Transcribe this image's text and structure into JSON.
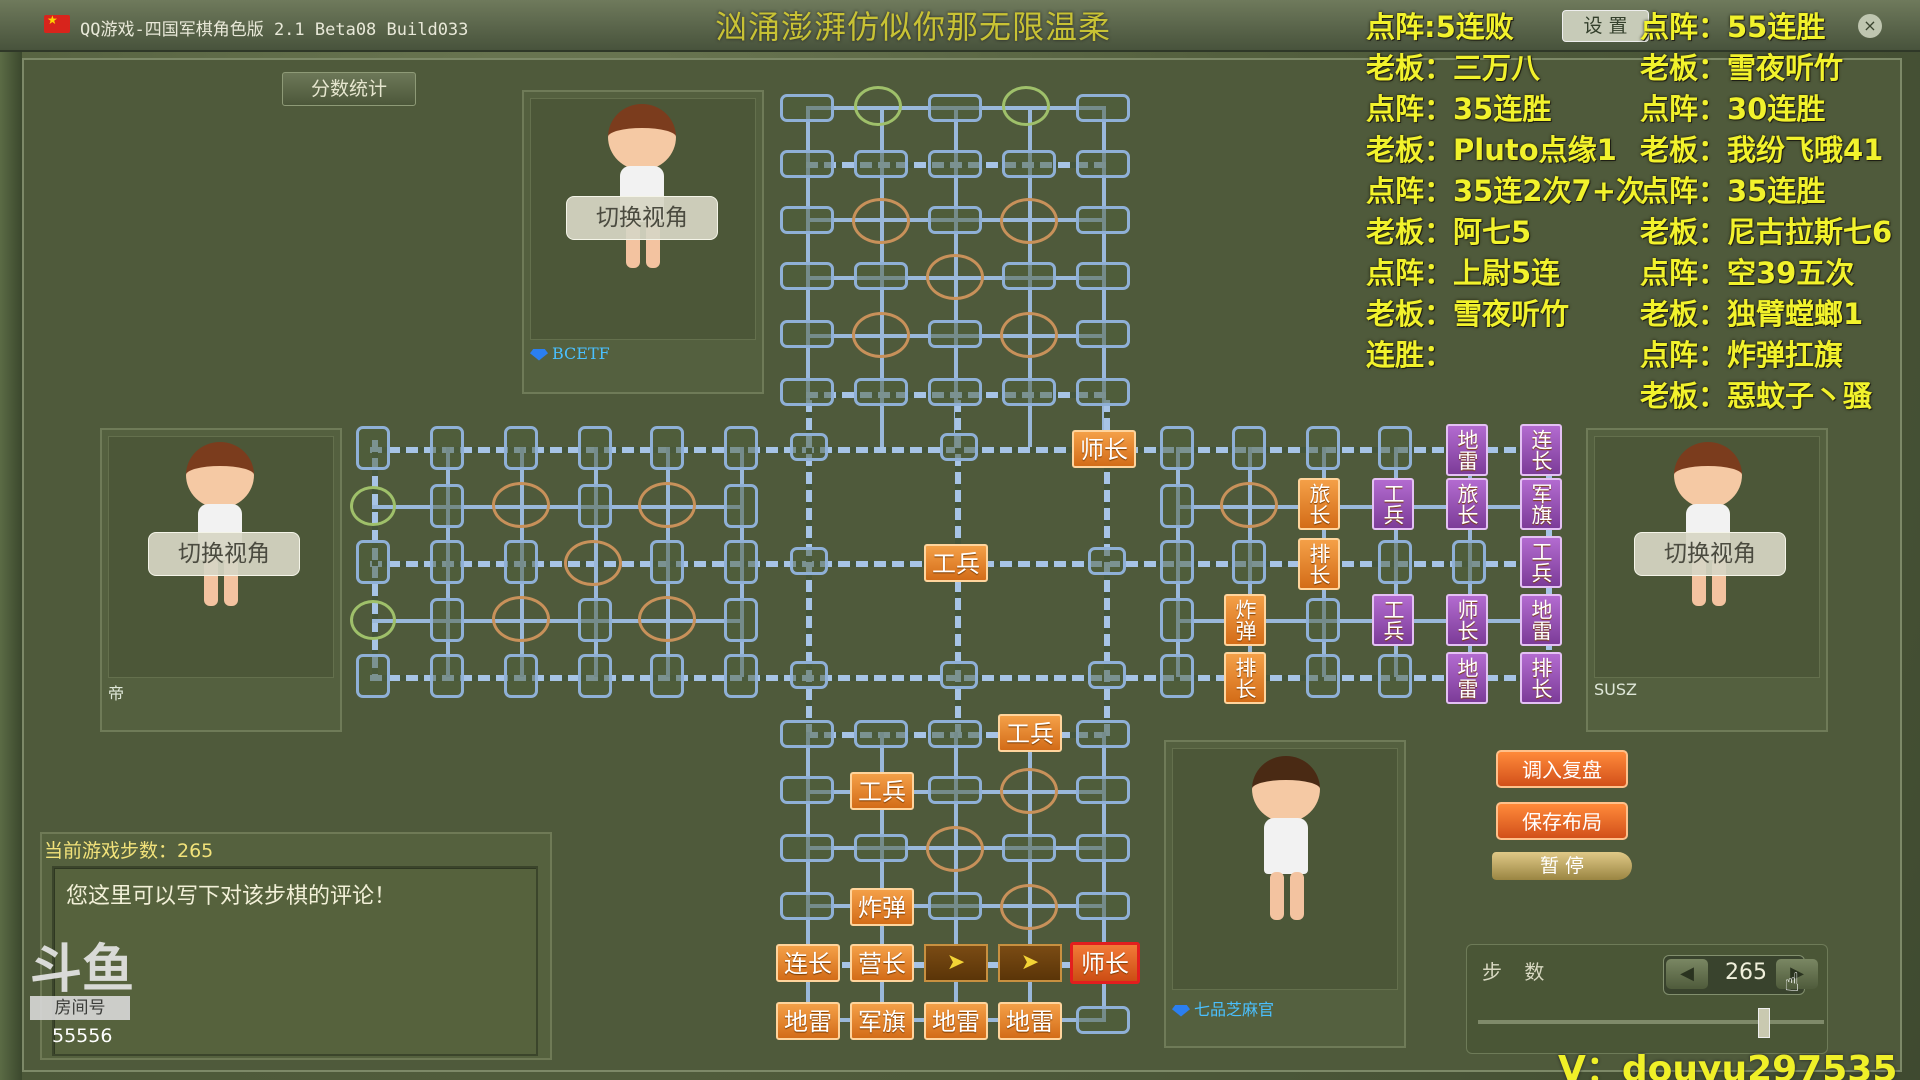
{
  "window": {
    "title": "QQ游戏-四国军棋角色版 2.1 Beta08 Build033",
    "song": "汹涌澎湃仿似你那无限温柔",
    "settings_label": "设 置",
    "close_label": "×"
  },
  "left_panel": {
    "score_stats": "分数统计",
    "switch_view": "切换视角"
  },
  "players": {
    "top": {
      "name": "BCETF"
    },
    "left": {
      "name": "帝"
    },
    "right": {
      "name": "SUSZ"
    },
    "bottom": {
      "name": "七品芝麻官"
    }
  },
  "comment": {
    "header": "当前游戏步数：265",
    "placeholder": "您这里可以写下对该步棋的评论！"
  },
  "douyu": {
    "mark": "斗鱼",
    "room_label": "房间号",
    "room_number": "55556"
  },
  "actions": {
    "load_replay": "调入复盘",
    "save_layout": "保存布局",
    "pause": "暂 停"
  },
  "steps": {
    "label": "步 数",
    "value": "265",
    "prev": "◀",
    "next": "▶"
  },
  "overlay": {
    "left_col": [
      "点阵:5连败",
      "老板：三万八",
      "点阵：35连胜",
      "老板：Pluto点缘1",
      "点阵：35连2次7+次",
      "老板：阿七5",
      "点阵：上尉5连",
      "老板：雪夜听竹",
      "连胜："
    ],
    "right_col": [
      "点阵：55连胜",
      "老板：雪夜听竹",
      "点阵：30连胜",
      "老板：我纷飞哦41",
      "点阵：35连胜",
      "老板：尼古拉斯七6",
      "点阵：空39五次",
      "老板：独臂螳螂1",
      "点阵：炸弹扛旗",
      "老板：惡蚊子丶骚"
    ],
    "contact": "V：douyu297535"
  },
  "pieces": {
    "center": {
      "shizhang": "师长",
      "gongbing": "工兵"
    },
    "bottom": [
      "工兵",
      "工兵",
      "炸弹",
      "连长",
      "营长",
      "师长",
      "地雷",
      "军旗",
      "地雷",
      "地雷"
    ],
    "arrow": "➤",
    "right_orange": [
      "旅长",
      "排长",
      "炸弹",
      "排长"
    ],
    "right_purple": [
      "地雷",
      "连长",
      "工兵",
      "旅长",
      "军旗",
      "工兵",
      "工兵",
      "师长",
      "地雷",
      "地雷",
      "排长"
    ]
  },
  "colors": {
    "accent": "#f2f22c",
    "piece_orange": "#e8802a",
    "piece_purple": "#9a52b8",
    "board_line": "#9ab8da"
  }
}
